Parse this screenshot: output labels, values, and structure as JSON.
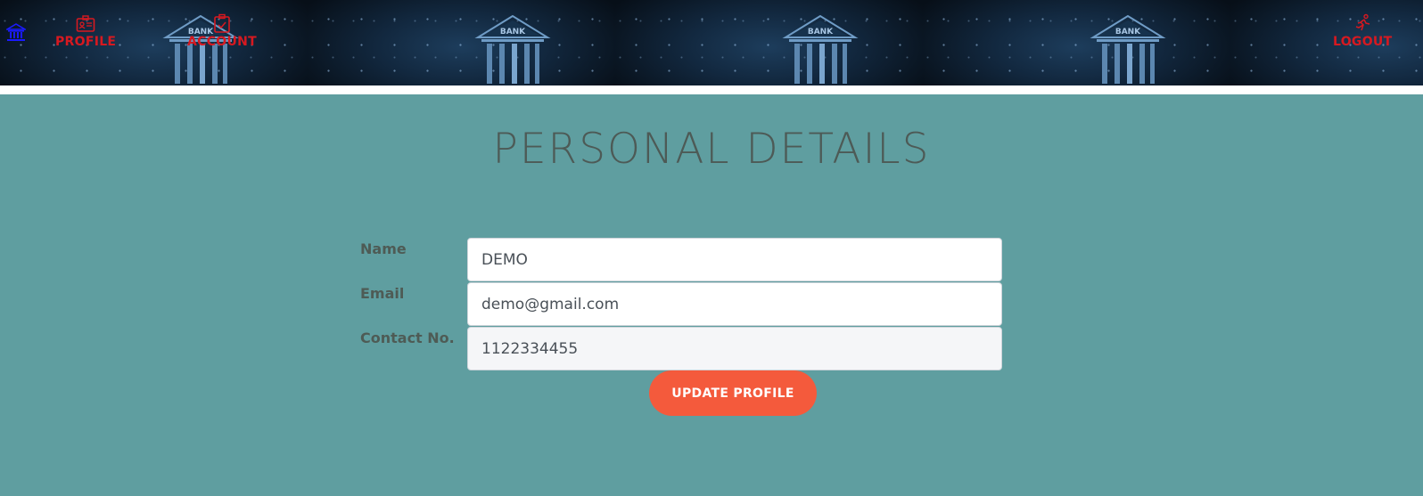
{
  "header": {
    "banner_word": "BANK",
    "nav": {
      "home_icon": "bank-icon",
      "profile": {
        "label": "PROFILE",
        "icon": "id-card-icon"
      },
      "account": {
        "label": "ACCOUNT",
        "icon": "clipboard-icon"
      },
      "logout": {
        "label": "LOGOUT",
        "icon": "running-man-icon"
      }
    },
    "colors": {
      "nav_text": "#d71920",
      "home_icon": "#1a1aff",
      "background": "#0a1420"
    }
  },
  "main": {
    "title": "PERSONAL DETAILS",
    "background": "#5f9ea0",
    "fields": {
      "name": {
        "label": "Name",
        "value": "DEMO"
      },
      "email": {
        "label": "Email",
        "value": "demo@gmail.com"
      },
      "contact": {
        "label": "Contact No.",
        "value": "1122334455"
      }
    },
    "update_button": {
      "label": "UPDATE PROFILE",
      "color": "#f45a3c"
    }
  }
}
